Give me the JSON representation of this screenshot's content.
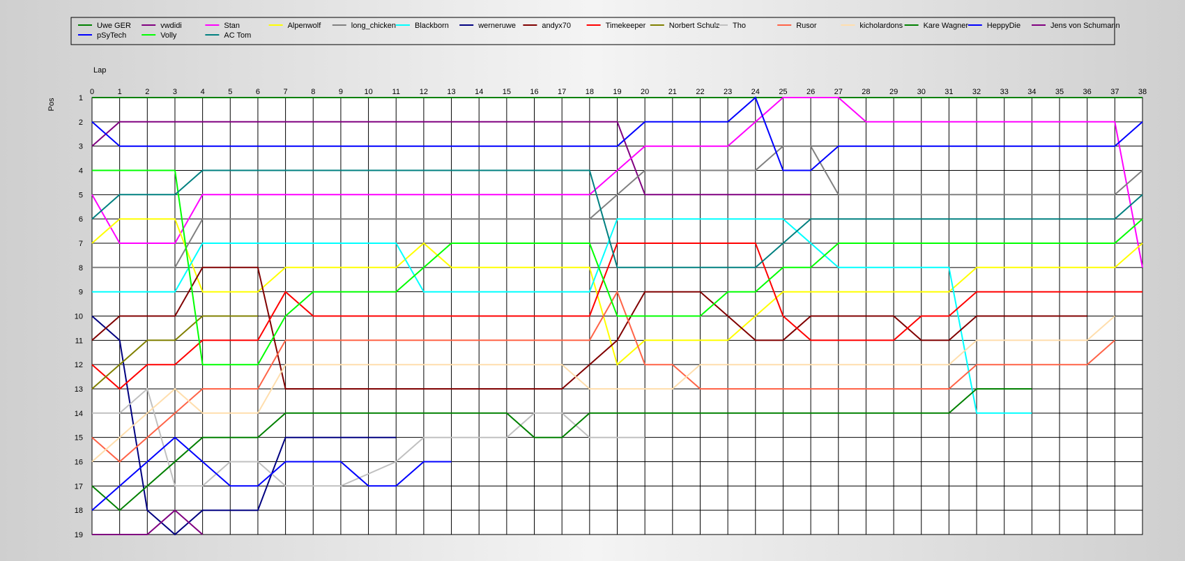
{
  "chart_data": {
    "type": "line",
    "x_axis_label": "Lap",
    "y_axis_label": "Pos",
    "xlim": [
      0,
      38
    ],
    "ylim": [
      1,
      19
    ],
    "y_inverted": true,
    "grid": true,
    "legend_placement": "top",
    "series": [
      {
        "name": "Uwe GER",
        "color": "#008000",
        "points": [
          [
            0,
            1
          ],
          [
            23,
            1
          ],
          [
            28,
            1
          ],
          [
            38,
            1
          ]
        ]
      },
      {
        "name": "vwdidi",
        "color": "#800080",
        "points": [
          [
            0,
            3
          ],
          [
            1,
            2
          ],
          [
            19,
            2
          ],
          [
            20,
            5
          ],
          [
            25,
            5
          ],
          [
            26,
            5
          ]
        ]
      },
      {
        "name": "Stan",
        "color": "#ff00ff",
        "points": [
          [
            0,
            5
          ],
          [
            1,
            7
          ],
          [
            3,
            7
          ],
          [
            4,
            5
          ],
          [
            18,
            5
          ],
          [
            20,
            3
          ],
          [
            23,
            3
          ],
          [
            25,
            1
          ],
          [
            27,
            1
          ],
          [
            28,
            2
          ],
          [
            37,
            2
          ],
          [
            38,
            8
          ]
        ]
      },
      {
        "name": "Alpenwolf",
        "color": "#ffff00",
        "points": [
          [
            0,
            7
          ],
          [
            1,
            6
          ],
          [
            3,
            6
          ],
          [
            4,
            9
          ],
          [
            6,
            9
          ],
          [
            7,
            8
          ],
          [
            11,
            8
          ],
          [
            12,
            7
          ],
          [
            13,
            8
          ],
          [
            18,
            8
          ],
          [
            19,
            12
          ],
          [
            20,
            11
          ],
          [
            23,
            11
          ],
          [
            25,
            9
          ],
          [
            31,
            9
          ],
          [
            32,
            8
          ],
          [
            37,
            8
          ],
          [
            38,
            7
          ]
        ]
      },
      {
        "name": "long_chicken",
        "color": "#808080",
        "points": [
          [
            0,
            8
          ],
          [
            3,
            8
          ],
          [
            4,
            6
          ],
          [
            18,
            6
          ],
          [
            20,
            4
          ],
          [
            24,
            4
          ],
          [
            25,
            3
          ],
          [
            26,
            3
          ],
          [
            27,
            5
          ],
          [
            37,
            5
          ],
          [
            38,
            4
          ]
        ]
      },
      {
        "name": "Blackborn",
        "color": "#00ffff",
        "points": [
          [
            0,
            9
          ],
          [
            3,
            9
          ],
          [
            4,
            7
          ],
          [
            11,
            7
          ],
          [
            12,
            9
          ],
          [
            18,
            9
          ],
          [
            19,
            6
          ],
          [
            25,
            6
          ],
          [
            27,
            8
          ],
          [
            31,
            8
          ],
          [
            32,
            14
          ],
          [
            34,
            14
          ]
        ]
      },
      {
        "name": "werneruwe",
        "color": "#000080",
        "points": [
          [
            0,
            10
          ],
          [
            1,
            11
          ],
          [
            2,
            18
          ],
          [
            3,
            19
          ],
          [
            4,
            18
          ],
          [
            6,
            18
          ],
          [
            7,
            15
          ],
          [
            11,
            15
          ]
        ]
      },
      {
        "name": "andyx70",
        "color": "#800000",
        "points": [
          [
            0,
            11
          ],
          [
            1,
            10
          ],
          [
            3,
            10
          ],
          [
            4,
            8
          ],
          [
            6,
            8
          ],
          [
            7,
            13
          ],
          [
            17,
            13
          ],
          [
            18,
            12
          ],
          [
            19,
            11
          ],
          [
            20,
            9
          ],
          [
            22,
            9
          ],
          [
            24,
            11
          ],
          [
            25,
            11
          ],
          [
            26,
            10
          ],
          [
            29,
            10
          ],
          [
            30,
            11
          ],
          [
            31,
            11
          ],
          [
            32,
            10
          ],
          [
            36,
            10
          ]
        ]
      },
      {
        "name": "Timekeeper",
        "color": "#ff0000",
        "points": [
          [
            0,
            12
          ],
          [
            1,
            13
          ],
          [
            2,
            12
          ],
          [
            3,
            12
          ],
          [
            4,
            11
          ],
          [
            6,
            11
          ],
          [
            7,
            9
          ],
          [
            8,
            10
          ],
          [
            18,
            10
          ],
          [
            19,
            7
          ],
          [
            24,
            7
          ],
          [
            25,
            10
          ],
          [
            26,
            11
          ],
          [
            29,
            11
          ],
          [
            30,
            10
          ],
          [
            31,
            10
          ],
          [
            32,
            9
          ],
          [
            38,
            9
          ]
        ]
      },
      {
        "name": "Norbert Schulz",
        "color": "#808000",
        "points": [
          [
            0,
            13
          ],
          [
            2,
            11
          ],
          [
            3,
            11
          ],
          [
            4,
            10
          ],
          [
            6,
            10
          ]
        ]
      },
      {
        "name": "Tho",
        "color": "#c0c0c0",
        "points": [
          [
            0,
            14
          ],
          [
            1,
            14
          ],
          [
            2,
            13
          ],
          [
            3,
            17
          ],
          [
            4,
            17
          ],
          [
            5,
            16
          ],
          [
            6,
            16
          ],
          [
            7,
            17
          ],
          [
            9,
            17
          ],
          [
            11,
            16
          ],
          [
            12,
            15
          ],
          [
            15,
            15
          ],
          [
            16,
            14
          ],
          [
            17,
            14
          ],
          [
            18,
            15
          ],
          [
            20,
            15
          ]
        ]
      },
      {
        "name": "Rusor",
        "color": "#ff6347",
        "points": [
          [
            0,
            15
          ],
          [
            1,
            16
          ],
          [
            2,
            15
          ],
          [
            4,
            13
          ],
          [
            6,
            13
          ],
          [
            7,
            11
          ],
          [
            18,
            11
          ],
          [
            19,
            9
          ],
          [
            20,
            12
          ],
          [
            21,
            12
          ],
          [
            22,
            13
          ],
          [
            31,
            13
          ],
          [
            32,
            12
          ],
          [
            36,
            12
          ],
          [
            37,
            11
          ]
        ]
      },
      {
        "name": "kicholardons",
        "color": "#ffdead",
        "points": [
          [
            0,
            16
          ],
          [
            2,
            14
          ],
          [
            3,
            13
          ],
          [
            4,
            14
          ],
          [
            6,
            14
          ],
          [
            7,
            12
          ],
          [
            17,
            12
          ],
          [
            18,
            13
          ],
          [
            21,
            13
          ],
          [
            22,
            12
          ],
          [
            31,
            12
          ],
          [
            32,
            11
          ],
          [
            36,
            11
          ],
          [
            37,
            10
          ]
        ]
      },
      {
        "name": "Kare Wagner",
        "color": "#008000",
        "points": [
          [
            0,
            17
          ],
          [
            1,
            18
          ],
          [
            4,
            15
          ],
          [
            6,
            15
          ],
          [
            7,
            14
          ],
          [
            15,
            14
          ],
          [
            16,
            15
          ],
          [
            17,
            15
          ],
          [
            18,
            14
          ],
          [
            31,
            14
          ],
          [
            32,
            13
          ],
          [
            34,
            13
          ]
        ]
      },
      {
        "name": "HeppyDie",
        "color": "#0000ff",
        "points": [
          [
            0,
            2
          ],
          [
            1,
            3
          ],
          [
            19,
            3
          ],
          [
            20,
            2
          ],
          [
            23,
            2
          ],
          [
            24,
            1
          ],
          [
            25,
            4
          ],
          [
            26,
            4
          ],
          [
            27,
            3
          ],
          [
            37,
            3
          ],
          [
            38,
            2
          ]
        ]
      },
      {
        "name": "Jens von Schumann",
        "color": "#800080",
        "points": [
          [
            0,
            19
          ],
          [
            2,
            19
          ],
          [
            3,
            18
          ],
          [
            4,
            19
          ]
        ]
      },
      {
        "name": "pSyTech",
        "color": "#0000ff",
        "points": [
          [
            0,
            18
          ],
          [
            3,
            15
          ],
          [
            4,
            16
          ],
          [
            5,
            17
          ],
          [
            6,
            17
          ],
          [
            7,
            16
          ],
          [
            9,
            16
          ],
          [
            10,
            17
          ],
          [
            11,
            17
          ],
          [
            12,
            16
          ],
          [
            13,
            16
          ]
        ]
      },
      {
        "name": "Volly",
        "color": "#00ff00",
        "points": [
          [
            0,
            4
          ],
          [
            3,
            4
          ],
          [
            4,
            12
          ],
          [
            6,
            12
          ],
          [
            7,
            10
          ],
          [
            8,
            9
          ],
          [
            11,
            9
          ],
          [
            13,
            7
          ],
          [
            18,
            7
          ],
          [
            19,
            10
          ],
          [
            22,
            10
          ],
          [
            23,
            9
          ],
          [
            24,
            9
          ],
          [
            25,
            8
          ],
          [
            26,
            8
          ],
          [
            27,
            7
          ],
          [
            37,
            7
          ],
          [
            38,
            6
          ]
        ]
      },
      {
        "name": "AC Tom",
        "color": "#008080",
        "points": [
          [
            0,
            6
          ],
          [
            1,
            5
          ],
          [
            3,
            5
          ],
          [
            4,
            4
          ],
          [
            18,
            4
          ],
          [
            19,
            8
          ],
          [
            24,
            8
          ],
          [
            26,
            6
          ],
          [
            37,
            6
          ],
          [
            38,
            5
          ]
        ]
      }
    ]
  }
}
